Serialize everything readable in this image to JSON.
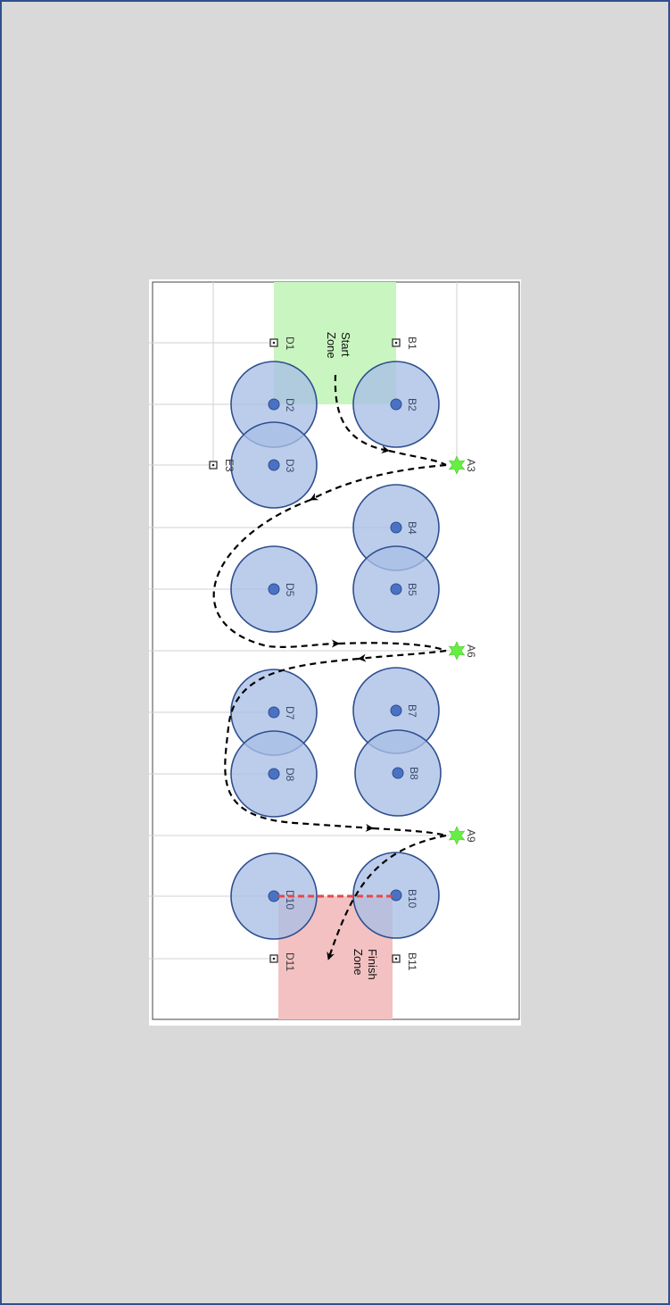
{
  "zones": {
    "start": {
      "line1": "Start",
      "line2": "Zone",
      "color": "#c9f5c0"
    },
    "finish": {
      "line1": "Finish",
      "line2": "Zone",
      "color": "#f3c1c2"
    }
  },
  "colors": {
    "cone_fill": "#a9bfe6",
    "cone_stroke": "#2f4f8f",
    "center_dot": "#4a72c4",
    "star": "#66ee44",
    "finish_line": "#e24a4a"
  },
  "markers": {
    "squares": [
      {
        "id": "sq-d1",
        "label": "D1"
      },
      {
        "id": "sq-b1",
        "label": "B1"
      },
      {
        "id": "sq-e3",
        "label": "E3"
      },
      {
        "id": "sq-d11",
        "label": "D11"
      },
      {
        "id": "sq-b11",
        "label": "B11"
      }
    ],
    "cones": [
      {
        "id": "cone-d2",
        "label": "D2"
      },
      {
        "id": "cone-b2",
        "label": "B2"
      },
      {
        "id": "cone-d3",
        "label": "D3"
      },
      {
        "id": "cone-b4",
        "label": "B4"
      },
      {
        "id": "cone-b5",
        "label": "B5"
      },
      {
        "id": "cone-d5",
        "label": "D5"
      },
      {
        "id": "cone-d7",
        "label": "D7"
      },
      {
        "id": "cone-b7",
        "label": "B7"
      },
      {
        "id": "cone-d8",
        "label": "D8"
      },
      {
        "id": "cone-b8",
        "label": "B8"
      },
      {
        "id": "cone-d10",
        "label": "D10"
      },
      {
        "id": "cone-b10",
        "label": "B10"
      }
    ],
    "stars": [
      {
        "id": "star-a3",
        "label": "A3"
      },
      {
        "id": "star-a6",
        "label": "A6"
      },
      {
        "id": "star-a9",
        "label": "A9"
      }
    ]
  }
}
